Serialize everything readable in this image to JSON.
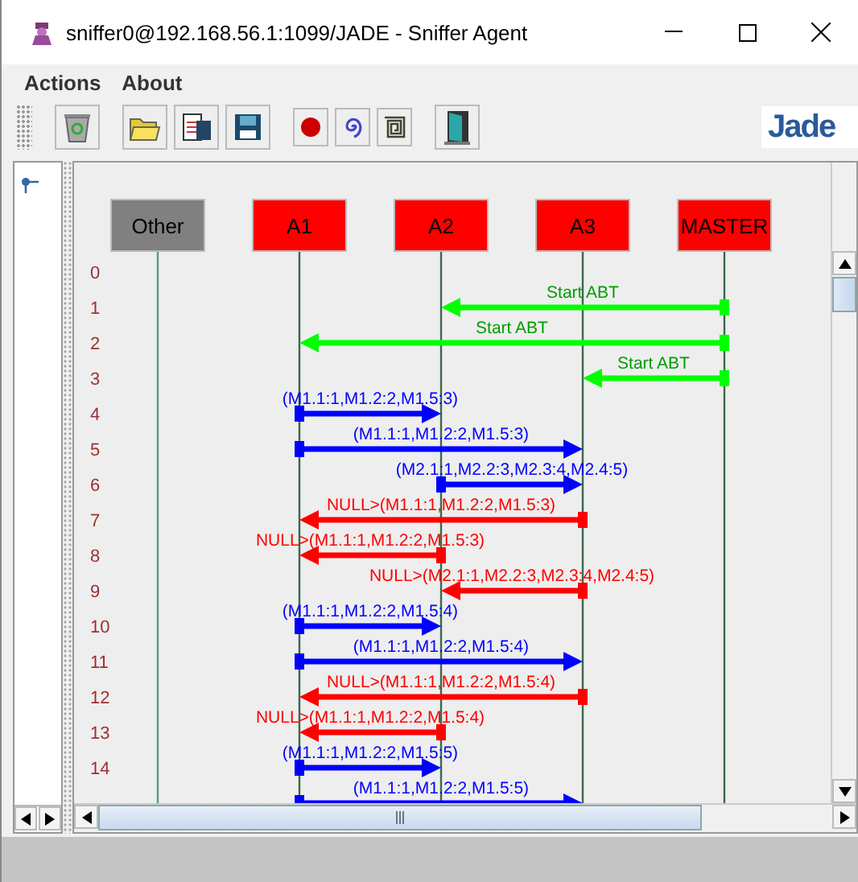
{
  "window": {
    "title": "sniffer0@192.168.56.1:1099/JADE - Sniffer Agent"
  },
  "menu": [
    "Actions",
    "About"
  ],
  "logo": {
    "text": "Jade"
  },
  "agents": [
    {
      "name": "Other",
      "color": "#808080"
    },
    {
      "name": "A1",
      "color": "#ff0000"
    },
    {
      "name": "A2",
      "color": "#ff0000"
    },
    {
      "name": "A3",
      "color": "#ff0000"
    },
    {
      "name": "MASTER",
      "color": "#ff0000"
    }
  ],
  "row_numbers": [
    "0",
    "1",
    "2",
    "3",
    "4",
    "5",
    "6",
    "7",
    "8",
    "9",
    "10",
    "11",
    "12",
    "13",
    "14"
  ],
  "messages": [
    {
      "label": "Start ABT",
      "color": "#00ff00"
    },
    {
      "label": "Start ABT",
      "color": "#00ff00"
    },
    {
      "label": "Start ABT",
      "color": "#00ff00"
    },
    {
      "label": "(M1.1:1,M1.2:2,M1.5:3)",
      "color": "#0000ff"
    },
    {
      "label": "(M1.1:1,M1.2:2,M1.5:3)",
      "color": "#0000ff"
    },
    {
      "label": "(M2.1:1,M2.2:3,M2.3:4,M2.4:5)",
      "color": "#0000ff"
    },
    {
      "label": "NULL>(M1.1:1,M1.2:2,M1.5:3)",
      "color": "#ff0000"
    },
    {
      "label": "NULL>(M1.1:1,M1.2:2,M1.5:3)",
      "color": "#ff0000"
    },
    {
      "label": "NULL>(M2.1:1,M2.2:3,M2.3:4,M2.4:5)",
      "color": "#ff0000"
    },
    {
      "label": "(M1.1:1,M1.2:2,M1.5:4)",
      "color": "#0000ff"
    },
    {
      "label": "(M1.1:1,M1.2:2,M1.5:4)",
      "color": "#0000ff"
    },
    {
      "label": "NULL>(M1.1:1,M1.2:2,M1.5:4)",
      "color": "#ff0000"
    },
    {
      "label": "NULL>(M1.1:1,M1.2:2,M1.5:4)",
      "color": "#ff0000"
    },
    {
      "label": "(M1.1:1,M1.2:2,M1.5:5)",
      "color": "#0000ff"
    },
    {
      "label": "(M1.1:1,M1.2:2,M1.5:5)",
      "color": "#0000ff"
    }
  ]
}
